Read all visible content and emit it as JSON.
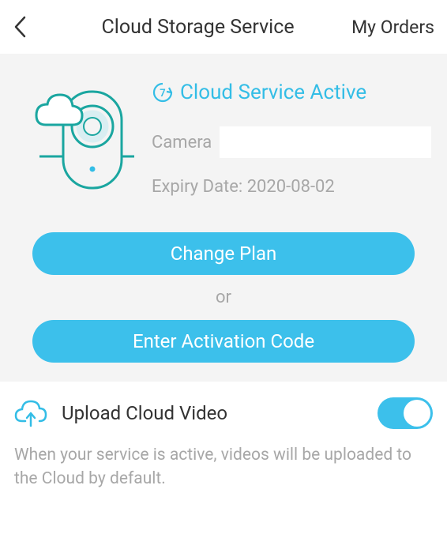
{
  "header": {
    "title": "Cloud Storage Service",
    "right_link": "My Orders"
  },
  "status": {
    "badge_number": "7",
    "text": "Cloud Service Active"
  },
  "camera": {
    "label": "Camera",
    "value": ""
  },
  "expiry": {
    "text": "Expiry Date: 2020-08-02"
  },
  "buttons": {
    "change_plan": "Change Plan",
    "or": "or",
    "activation": "Enter Activation Code"
  },
  "upload": {
    "label": "Upload Cloud Video",
    "enabled": true,
    "description": "When your service is active, videos will be uploaded to the Cloud by default."
  },
  "colors": {
    "accent": "#3cc0eb",
    "muted": "#a7a7a7"
  }
}
